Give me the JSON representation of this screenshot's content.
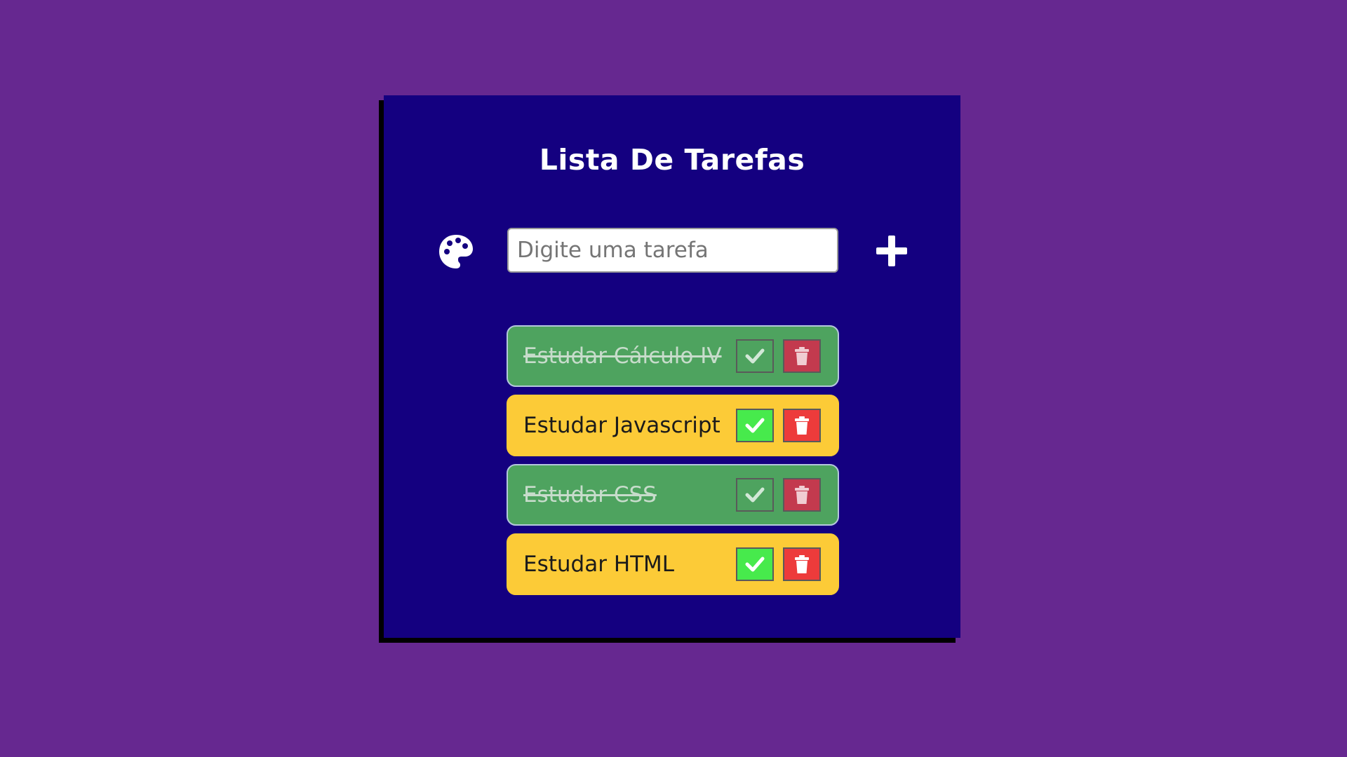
{
  "app": {
    "title": "Lista De Tarefas"
  },
  "input": {
    "placeholder": "Digite uma tarefa",
    "value": ""
  },
  "icons": {
    "theme": "palette-icon",
    "add": "plus-icon",
    "complete": "check-icon",
    "delete": "trash-icon"
  },
  "colors": {
    "background": "#662890",
    "panel": "#140080",
    "pending_task": "#fccb37",
    "completed_task": "#4ea35f",
    "check_button": "#47ea4c",
    "delete_button": "#ed3b3b"
  },
  "todos": [
    {
      "text": "Estudar Cálculo IV",
      "completed": true
    },
    {
      "text": "Estudar Javascript",
      "completed": false
    },
    {
      "text": "Estudar CSS",
      "completed": true
    },
    {
      "text": "Estudar HTML",
      "completed": false
    }
  ]
}
